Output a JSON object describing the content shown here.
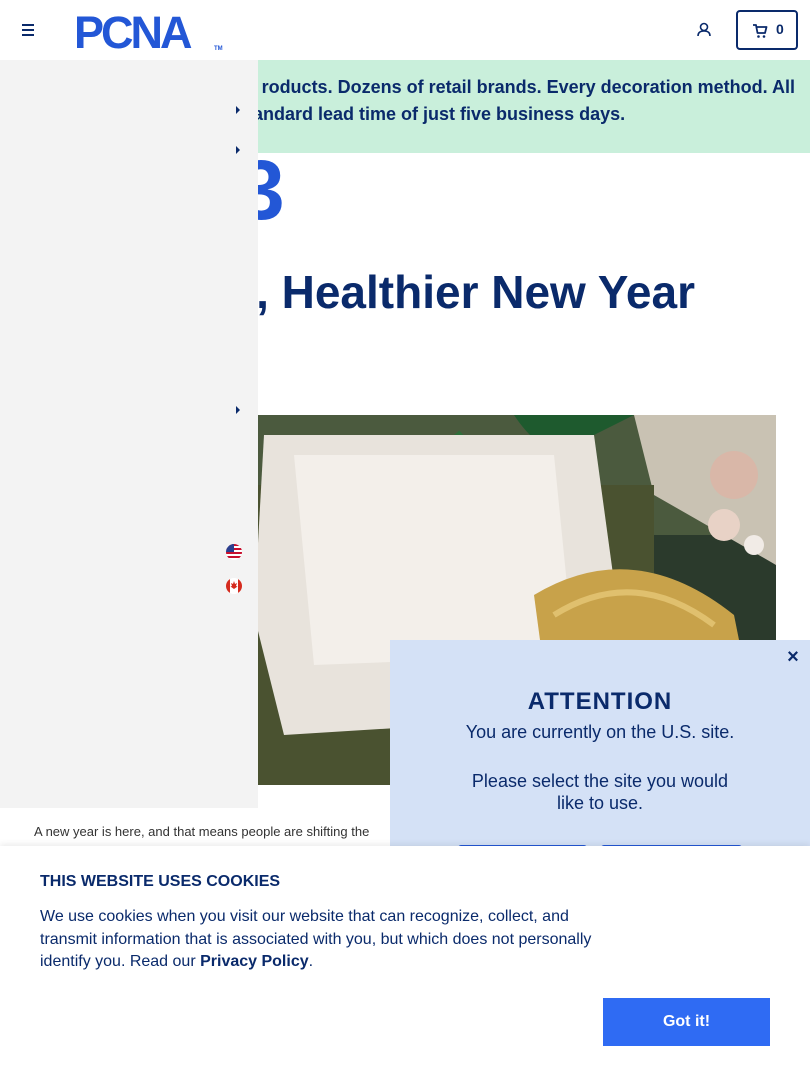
{
  "header": {
    "logo_text": "PCNA",
    "trademark": "TM",
    "cart_count": "0",
    "icons": {
      "menu": "hamburger-icon",
      "account": "user-icon",
      "cart": "cart-icon"
    }
  },
  "promo": {
    "text": "roducts. Dozens of retail brands. Every decoration method. All tandard lead time of just five business days.",
    "line1": "roducts. Dozens of retail brands. Every decoration method. All",
    "line2": "tandard lead time of just five business days."
  },
  "article": {
    "date_fragment": "3",
    "title": ", Healthier New Year",
    "body": "A new year is here, and that means people are shifting the"
  },
  "side_menu": {
    "flags": [
      "us-flag-icon",
      "canada-flag-icon"
    ]
  },
  "modal": {
    "title": "ATTENTION",
    "line1": "You are currently on the U.S. site.",
    "line2": "Please select the site you would like to use."
  },
  "cookie": {
    "title": "THIS WEBSITE USES COOKIES",
    "text": "We use cookies when you visit our website that can recognize, collect, and transmit information that is associated with you, but which does not personally identify you. Read our",
    "link": "Privacy Policy",
    "period": ".",
    "button": "Got it!"
  },
  "colors": {
    "navy": "#0a2a6b",
    "brand_blue": "#2357d6",
    "promo_bg": "#c9efdb",
    "modal_bg": "#d4e1f6",
    "button_blue": "#2f6bf3"
  }
}
